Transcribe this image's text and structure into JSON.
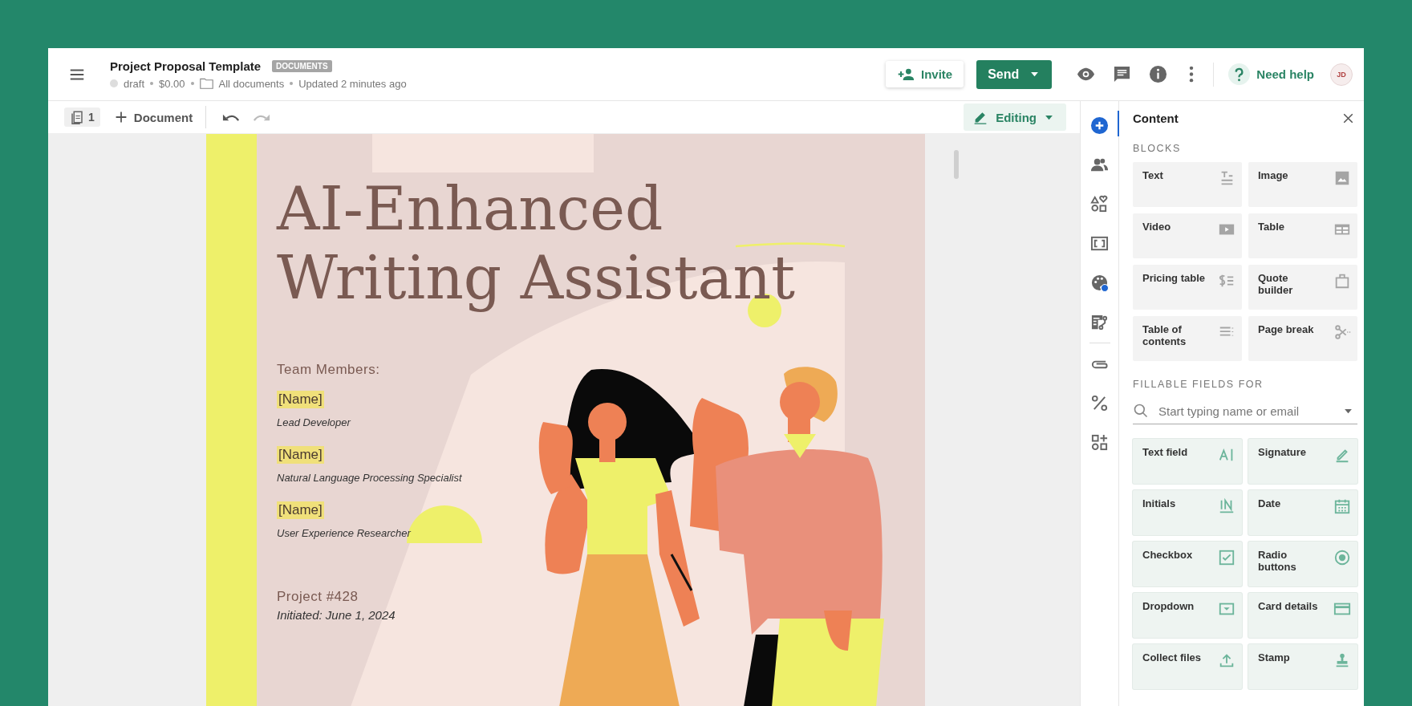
{
  "header": {
    "title": "Project Proposal Template",
    "badge": "DOCUMENTS",
    "status": "draft",
    "amount": "$0.00",
    "folder": "All documents",
    "updated": "Updated 2 minutes ago",
    "invite": "Invite",
    "send": "Send",
    "help": "Need help",
    "avatar": "JD"
  },
  "toolbar": {
    "page_count": "1",
    "add_label": "Document",
    "mode": "Editing"
  },
  "document": {
    "title_lines": [
      "AI-Enhanced",
      "Writing Assistant"
    ],
    "team_heading": "Team Members:",
    "members": [
      {
        "name": "[Name]",
        "role": "Lead Developer"
      },
      {
        "name": "[Name]",
        "role": "Natural Language Processing Specialist"
      },
      {
        "name": "[Name]",
        "role": "User Experience Researcher"
      }
    ],
    "project": "Project #428",
    "initiated": "Initiated: June 1, 2024"
  },
  "rail": {
    "top": [
      {
        "kind": "add",
        "selected": true,
        "dot": false
      },
      {
        "kind": "people",
        "selected": false,
        "dot": false
      },
      {
        "kind": "shapes",
        "selected": false,
        "dot": false
      },
      {
        "kind": "frame",
        "selected": false,
        "dot": false
      },
      {
        "kind": "palette",
        "selected": false,
        "dot": true
      },
      {
        "kind": "flow",
        "selected": false,
        "dot": false
      }
    ],
    "bottom": [
      {
        "kind": "clip",
        "selected": false,
        "dot": false
      },
      {
        "kind": "percent",
        "selected": false,
        "dot": false
      },
      {
        "kind": "widgets",
        "selected": false,
        "dot": false
      }
    ]
  },
  "panel": {
    "title": "Content",
    "sections": [
      {
        "heading": "BLOCKS",
        "kind": "blocks",
        "items": [
          {
            "label": "Text",
            "kind": "text"
          },
          {
            "label": "Image",
            "kind": "image"
          },
          {
            "label": "Video",
            "kind": "video"
          },
          {
            "label": "Table",
            "kind": "table"
          },
          {
            "label": "Pricing table",
            "kind": "pricing"
          },
          {
            "label": "Quote builder",
            "kind": "quote"
          },
          {
            "label": "Table of contents",
            "kind": "toc"
          },
          {
            "label": "Page break",
            "kind": "pagebreak"
          }
        ]
      },
      {
        "heading": "FILLABLE FIELDS FOR",
        "kind": "fields",
        "search": {
          "placeholder": "Start typing name or email"
        },
        "items": [
          {
            "label": "Text field",
            "kind": "textfield"
          },
          {
            "label": "Signature",
            "kind": "signature"
          },
          {
            "label": "Initials",
            "kind": "initials"
          },
          {
            "label": "Date",
            "kind": "date"
          },
          {
            "label": "Checkbox",
            "kind": "checkbox"
          },
          {
            "label": "Radio buttons",
            "kind": "radio"
          },
          {
            "label": "Dropdown",
            "kind": "dropdown"
          },
          {
            "label": "Card details",
            "kind": "card"
          },
          {
            "label": "Collect files",
            "kind": "upload"
          },
          {
            "label": "Stamp",
            "kind": "stamp"
          }
        ]
      }
    ]
  }
}
